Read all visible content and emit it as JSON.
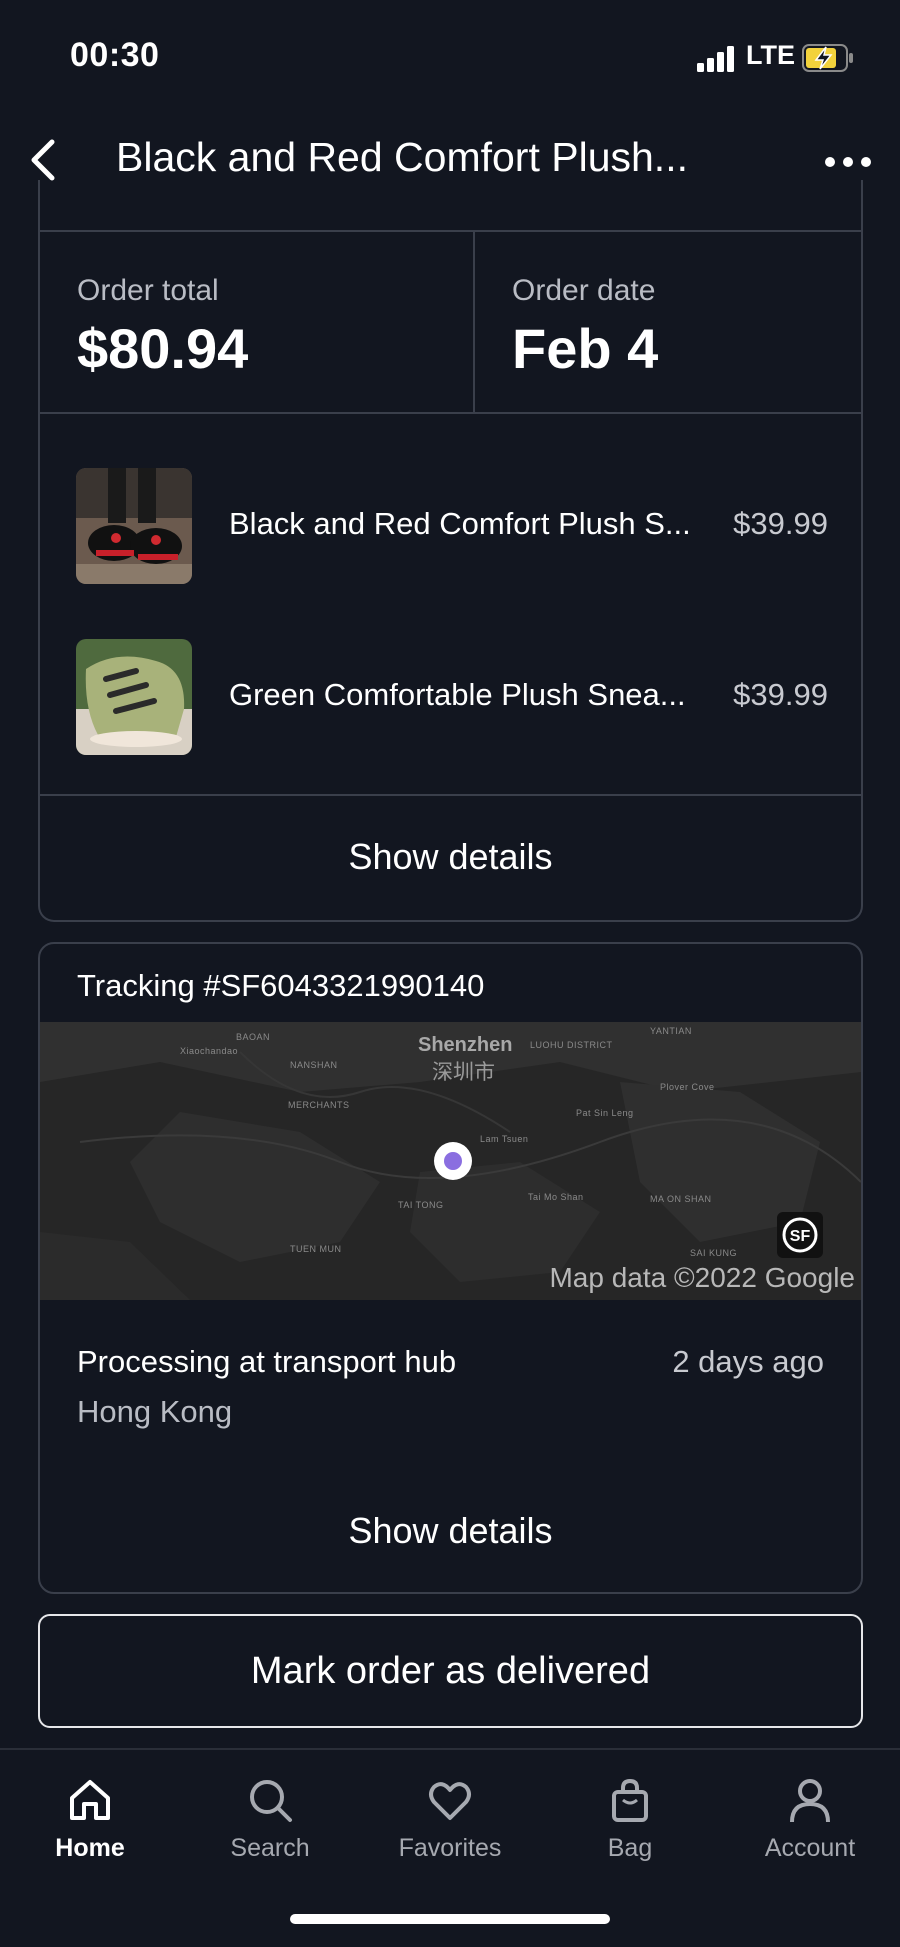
{
  "status_bar": {
    "time": "00:30",
    "network": "LTE",
    "icons": [
      "signal-icon",
      "battery-charging-icon"
    ]
  },
  "header": {
    "title": "Black and Red Comfort Plush...",
    "back_icon": "chevron-left-icon",
    "more_icon": "more-horizontal-icon"
  },
  "order": {
    "total_label": "Order total",
    "total_value": "$80.94",
    "date_label": "Order date",
    "date_value": "Feb 4",
    "items": [
      {
        "name": "Black and Red Comfort Plush S...",
        "price": "$39.99",
        "thumb": "black-red-sneakers-photo"
      },
      {
        "name": "Green Comfortable Plush Snea...",
        "price": "$39.99",
        "thumb": "green-plush-sneaker-photo"
      }
    ],
    "show_details_label": "Show details"
  },
  "tracking": {
    "number_label": "Tracking #SF6043321990140",
    "map": {
      "city_en": "Shenzhen",
      "city_cn": "深圳市",
      "attribution": "Map data ©2022 Google",
      "carrier_logo": "sf-express-logo"
    },
    "status": "Processing at transport hub",
    "time_ago": "2 days ago",
    "location": "Hong Kong",
    "show_details_label": "Show details"
  },
  "mark_delivered_label": "Mark order as delivered",
  "tab_bar": {
    "tabs": [
      {
        "label": "Home",
        "icon": "home-icon",
        "active": true
      },
      {
        "label": "Search",
        "icon": "search-icon",
        "active": false
      },
      {
        "label": "Favorites",
        "icon": "heart-icon",
        "active": false
      },
      {
        "label": "Bag",
        "icon": "bag-icon",
        "active": false
      },
      {
        "label": "Account",
        "icon": "user-icon",
        "active": false
      }
    ]
  },
  "colors": {
    "background": "#121620",
    "border": "#3a3f4b",
    "map_bg": "#262626",
    "pin": "#8a6ee0"
  }
}
